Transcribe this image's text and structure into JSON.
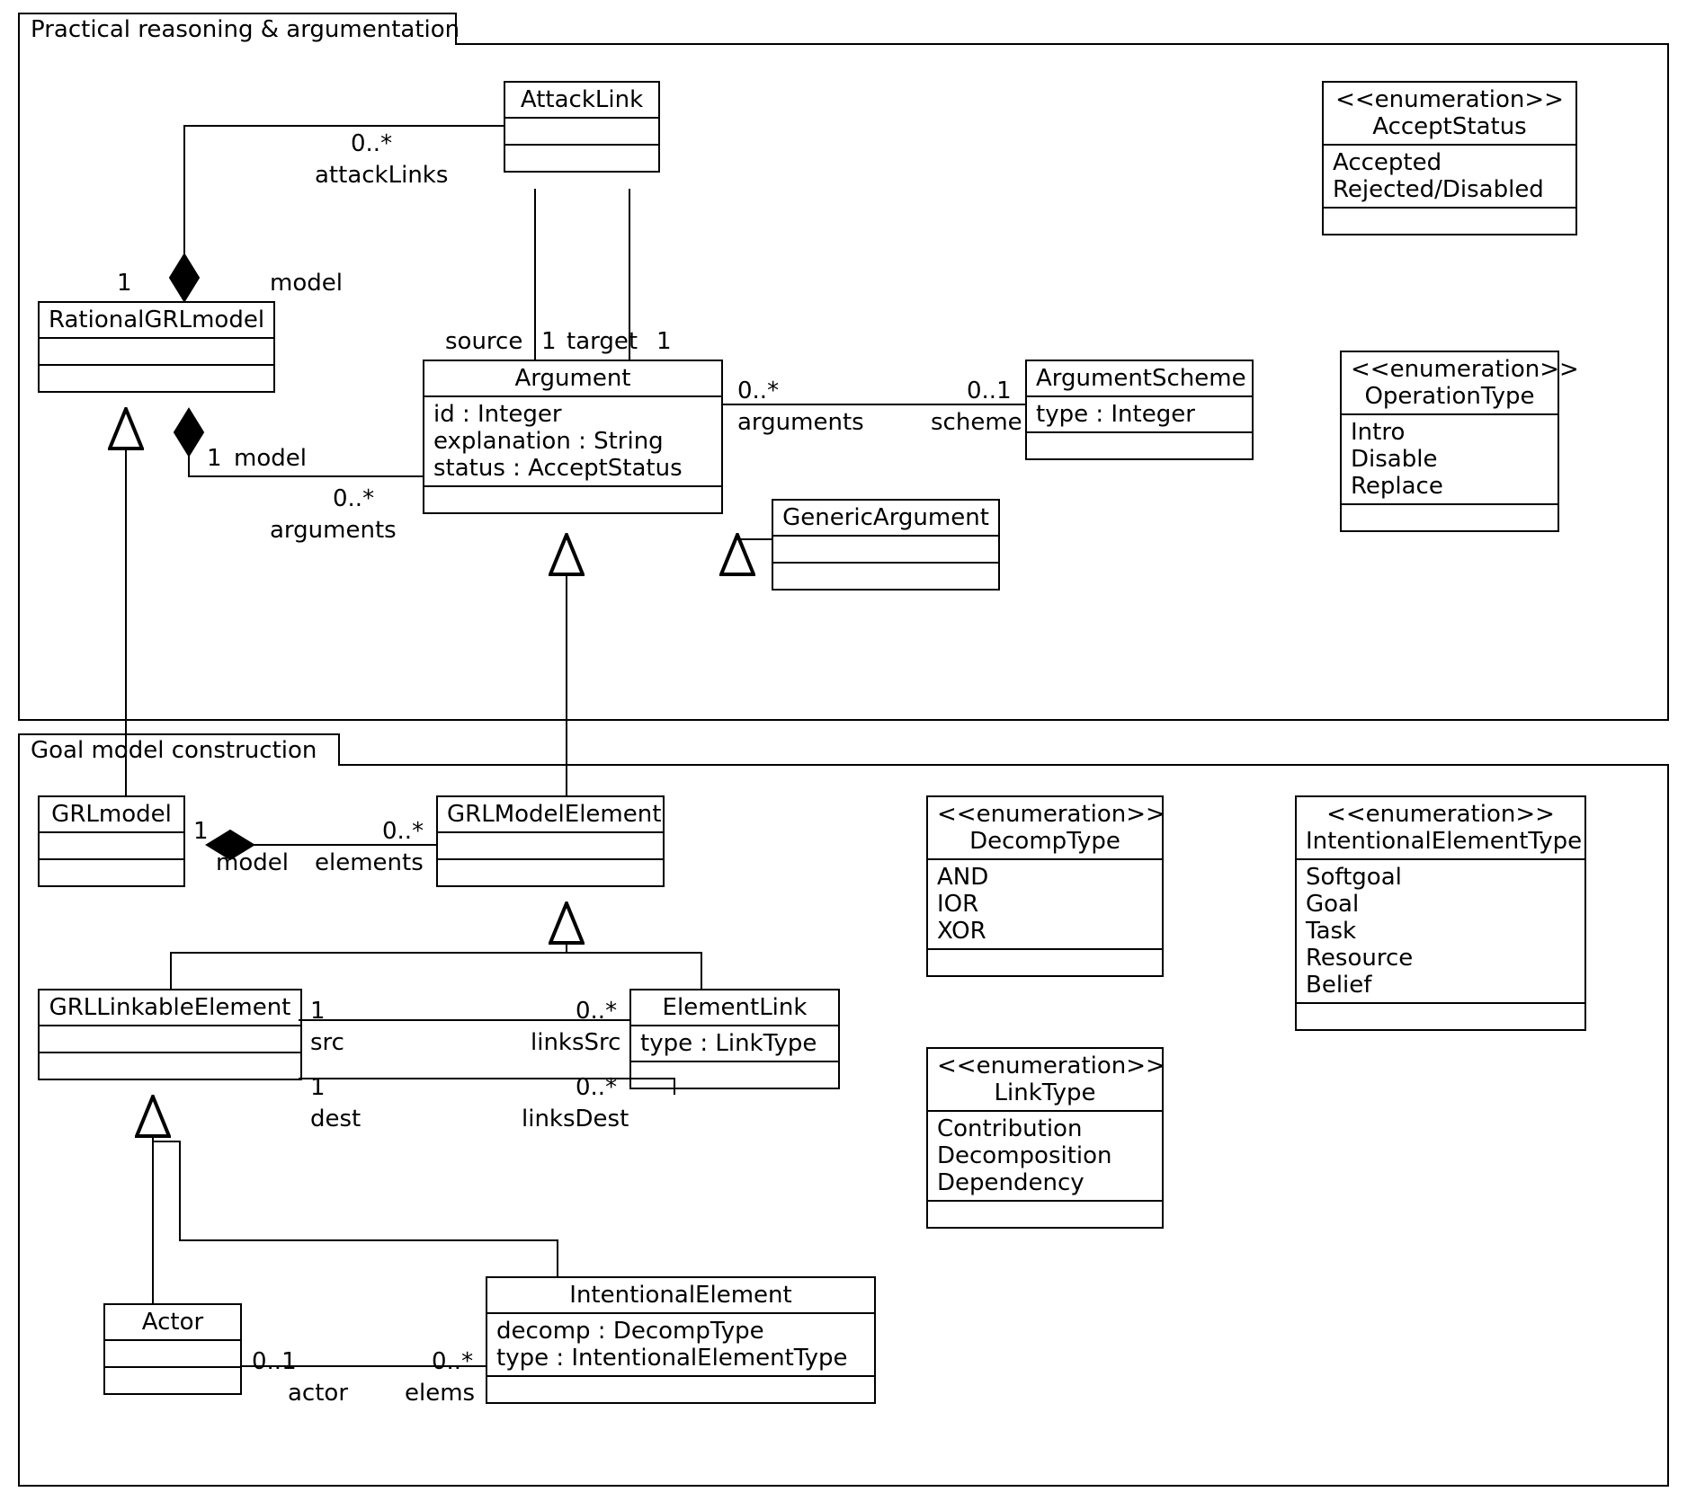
{
  "packages": {
    "p1": "Practical reasoning & argumentation",
    "p2": "Goal model construction"
  },
  "classes": {
    "attackLink": {
      "name": "AttackLink"
    },
    "rationalGRL": {
      "name": "RationalGRLmodel"
    },
    "argument": {
      "name": "Argument",
      "attrs": [
        "id : Integer",
        "explanation : String",
        "status : AcceptStatus"
      ]
    },
    "genericArgument": {
      "name": "GenericArgument"
    },
    "argumentScheme": {
      "name": "ArgumentScheme",
      "attrs": [
        "type : Integer"
      ]
    },
    "acceptStatus": {
      "stereo": "<<enumeration>>",
      "name": "AcceptStatus",
      "vals": [
        "Accepted",
        "Rejected/Disabled"
      ]
    },
    "operationType": {
      "stereo": "<<enumeration>>",
      "name": "OperationType",
      "vals": [
        "Intro",
        "Disable",
        "Replace"
      ]
    },
    "grlModel": {
      "name": "GRLmodel"
    },
    "grlModelElement": {
      "name": "GRLModelElement"
    },
    "grlLinkable": {
      "name": "GRLLinkableElement"
    },
    "elementLink": {
      "name": "ElementLink",
      "attrs": [
        "type : LinkType"
      ]
    },
    "actor": {
      "name": "Actor"
    },
    "intentionalElement": {
      "name": "IntentionalElement",
      "attrs": [
        "decomp : DecompType",
        "type : IntentionalElementType"
      ]
    },
    "decompType": {
      "stereo": "<<enumeration>>",
      "name": "DecompType",
      "vals": [
        "AND",
        "IOR",
        "XOR"
      ]
    },
    "linkType": {
      "stereo": "<<enumeration>>",
      "name": "LinkType",
      "vals": [
        "Contribution",
        "Decomposition",
        "Dependency"
      ]
    },
    "intElemType": {
      "stereo": "<<enumeration>>",
      "name": "IntentionalElementType",
      "vals": [
        "Softgoal",
        "Goal",
        "Task",
        "Resource",
        "Belief"
      ]
    }
  },
  "labels": {
    "l1": "0..*",
    "l2": "attackLinks",
    "l3": "1",
    "l4": "model",
    "l5": "source",
    "l6": "1",
    "l7": "target",
    "l8": "1",
    "l9": "1",
    "l10": "model",
    "l11": "0..*",
    "l12": "arguments",
    "l13": "0..*",
    "l14": "arguments",
    "l15": "0..1",
    "l16": "scheme",
    "l17": "1",
    "l18": "model",
    "l19": "0..*",
    "l20": "elements",
    "l21": "1",
    "l22": "src",
    "l23": "0..*",
    "l24": "linksSrc",
    "l25": "1",
    "l26": "dest",
    "l27": "0..*",
    "l28": "linksDest",
    "l29": "0..1",
    "l30": "actor",
    "l31": "0..*",
    "l32": "elems"
  }
}
